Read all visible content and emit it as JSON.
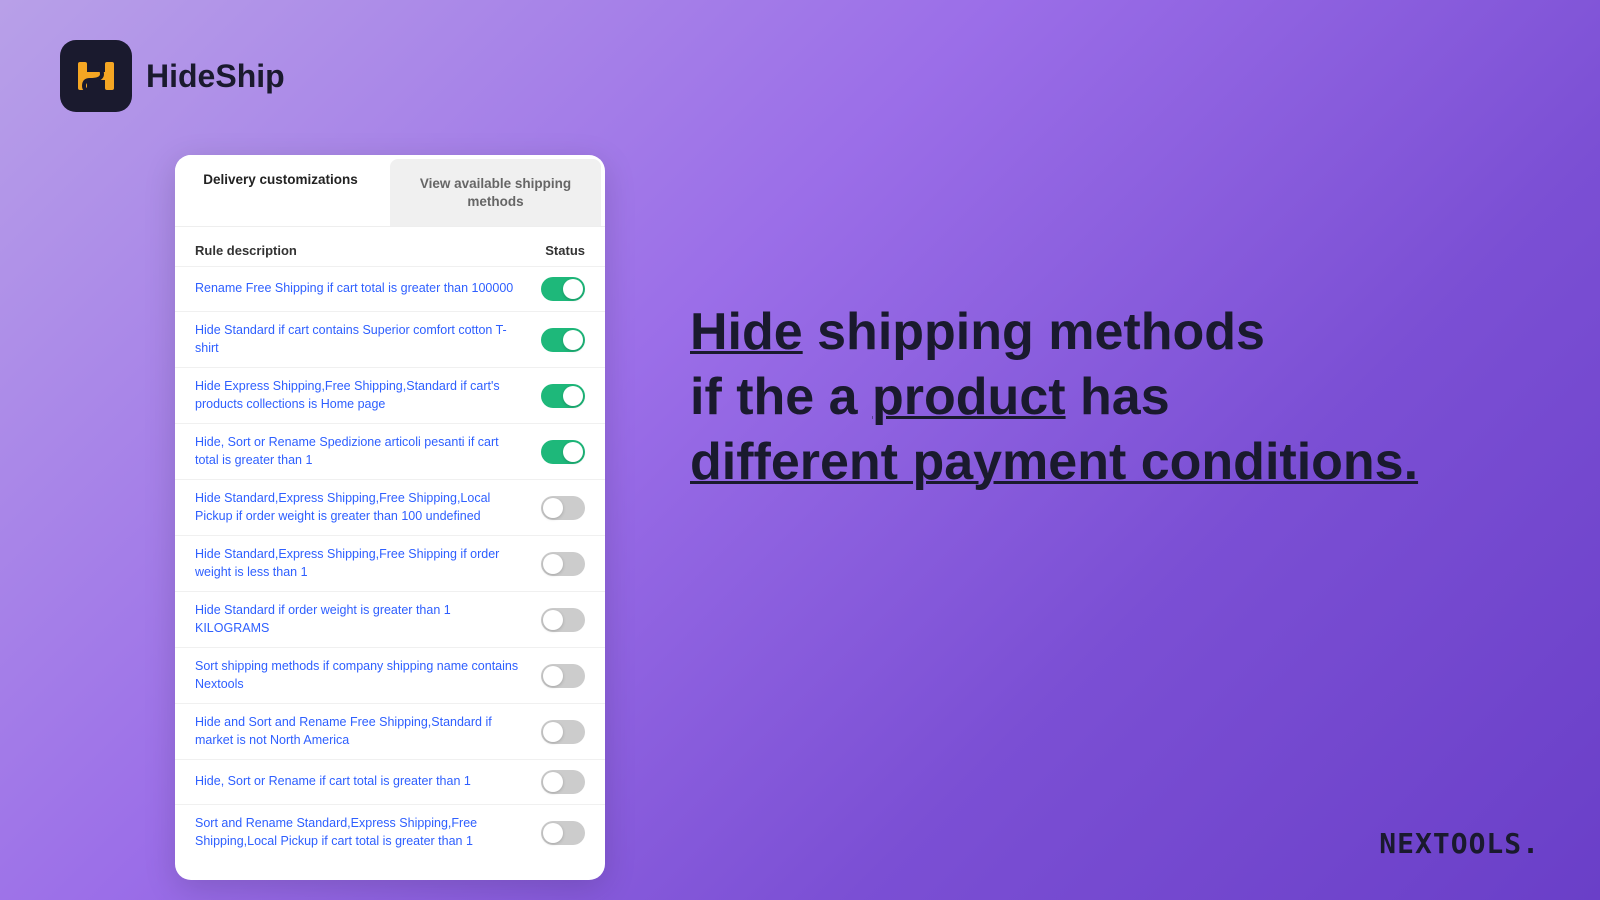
{
  "logo": {
    "app_name": "HideShip",
    "icon_label": "HS"
  },
  "card": {
    "tab_active": "Delivery customizations",
    "tab_inactive": "View available shipping methods",
    "table_col_rule": "Rule description",
    "table_col_status": "Status",
    "rules": [
      {
        "id": 1,
        "text": "Rename Free Shipping if cart total is greater than 100000",
        "enabled": true
      },
      {
        "id": 2,
        "text": "Hide Standard if cart contains Superior comfort cotton T-shirt",
        "enabled": true
      },
      {
        "id": 3,
        "text": "Hide Express Shipping,Free Shipping,Standard if cart's products collections is Home page",
        "enabled": true
      },
      {
        "id": 4,
        "text": "Hide, Sort or Rename Spedizione articoli pesanti if cart total is greater than 1",
        "enabled": true
      },
      {
        "id": 5,
        "text": "Hide Standard,Express Shipping,Free Shipping,Local Pickup if order weight is greater than 100 undefined",
        "enabled": false
      },
      {
        "id": 6,
        "text": "Hide Standard,Express Shipping,Free Shipping if order weight is less than 1",
        "enabled": false
      },
      {
        "id": 7,
        "text": "Hide Standard if order weight is greater than 1 KILOGRAMS",
        "enabled": false
      },
      {
        "id": 8,
        "text": "Sort shipping methods if company shipping name contains Nextools",
        "enabled": false
      },
      {
        "id": 9,
        "text": "Hide and Sort and Rename Free Shipping,Standard if market is not North America",
        "enabled": false
      },
      {
        "id": 10,
        "text": "Hide, Sort or Rename if cart total is greater than 1",
        "enabled": false
      },
      {
        "id": 11,
        "text": "Sort and Rename Standard,Express Shipping,Free Shipping,Local Pickup if cart total is greater than 1",
        "enabled": false
      }
    ]
  },
  "hero": {
    "line1_plain": "",
    "line1_underline": "Hide",
    "line1_rest": " shipping methods",
    "line2": "if the a ",
    "line2_underline": "product",
    "line2_rest": " has",
    "line3_underline": "different payment conditions."
  },
  "footer": {
    "brand": "NEXTOOLS."
  }
}
